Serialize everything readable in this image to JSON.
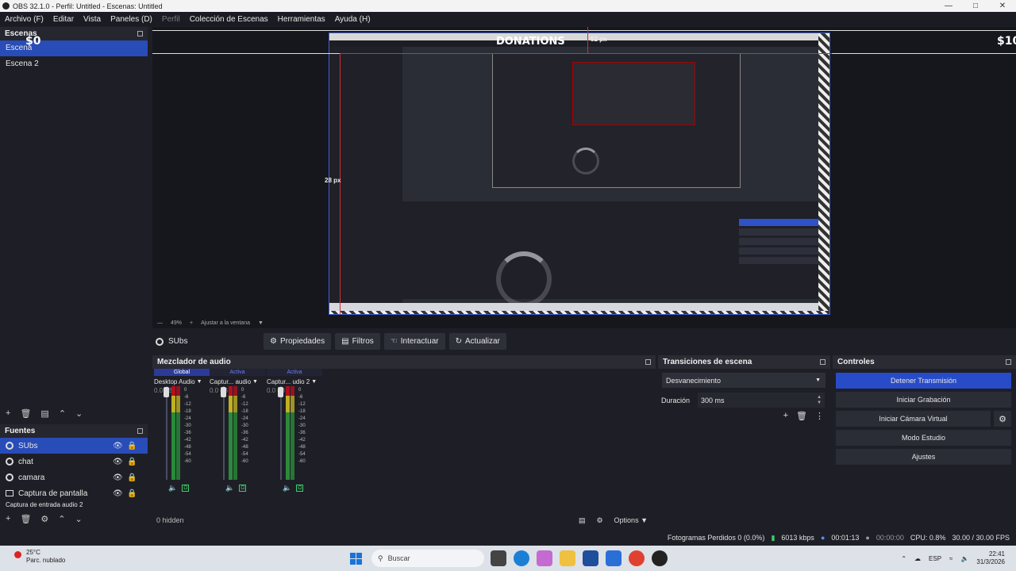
{
  "window": {
    "title": "OBS 32.1.0 - Perfil: Untitled - Escenas: Untitled"
  },
  "menu": [
    {
      "label": "Archivo (F)",
      "disabled": false
    },
    {
      "label": "Editar",
      "disabled": false
    },
    {
      "label": "Vista",
      "disabled": false
    },
    {
      "label": "Paneles (D)",
      "disabled": false
    },
    {
      "label": "Perfil",
      "disabled": true
    },
    {
      "label": "Colección de Escenas",
      "disabled": false
    },
    {
      "label": "Herramientas",
      "disabled": false
    },
    {
      "label": "Ayuda (H)",
      "disabled": false
    }
  ],
  "scenes": {
    "title": "Escenas",
    "items": [
      {
        "label": "Escena",
        "selected": true
      },
      {
        "label": "Escena 2",
        "selected": false
      }
    ]
  },
  "preview": {
    "overlay_left": "$0",
    "overlay_center": "DONATIONS",
    "overlay_right": "$10",
    "guide_top": "52 px",
    "guide_left": "28 px",
    "zoom": "49%",
    "fit_label": "Ajustar a la ventana"
  },
  "source_toolbar": {
    "source_name": "SUbs",
    "buttons": [
      {
        "label": "Propiedades",
        "icon": "gear-icon"
      },
      {
        "label": "Filtros",
        "icon": "filter-icon"
      },
      {
        "label": "Interactuar",
        "icon": "pointer-icon"
      },
      {
        "label": "Actualizar",
        "icon": "refresh-icon"
      }
    ]
  },
  "sources": {
    "title": "Fuentes",
    "items": [
      {
        "label": "SUbs",
        "selected": true
      },
      {
        "label": "chat",
        "selected": false
      },
      {
        "label": "camara",
        "selected": false
      },
      {
        "label": "Captura de pantalla",
        "selected": false
      },
      {
        "label": "Captura de entrada audio 2",
        "selected": false
      }
    ]
  },
  "mixer": {
    "title": "Mezclador de audio",
    "channels": [
      {
        "tag": "Global",
        "name": "Desktop Audio",
        "db": "0.0 dB"
      },
      {
        "tag": "Activa",
        "name": "Captur... audio",
        "db": "0.0 dB"
      },
      {
        "tag": "Activa",
        "name": "Captur... udio 2",
        "db": "0.0 dB"
      }
    ],
    "ticks": [
      "0",
      "-6",
      "-12",
      "-18",
      "-24",
      "-30",
      "-36",
      "-42",
      "-48",
      "-54",
      "-60"
    ],
    "hidden": "0 hidden",
    "options": "Options"
  },
  "transitions": {
    "title": "Transiciones de escena",
    "selected": "Desvanecimiento",
    "duration_label": "Duración",
    "duration_value": "300 ms"
  },
  "controls": {
    "title": "Controles",
    "buttons": [
      {
        "label": "Detener Transmisión",
        "active": true
      },
      {
        "label": "Iniciar Grabación",
        "active": false
      },
      {
        "label": "Iniciar Cámara Virtual",
        "active": false
      },
      {
        "label": "Modo Estudio",
        "active": false
      },
      {
        "label": "Ajustes",
        "active": false
      }
    ]
  },
  "status": {
    "dropped": "Fotogramas Perdidos 0 (0.0%)",
    "bitrate": "6013 kbps",
    "stream_time": "00:01:13",
    "rec_time": "00:00:00",
    "cpu": "CPU: 0.8%",
    "fps": "30.00 / 30.00 FPS"
  },
  "taskbar": {
    "temp": "25°C",
    "weather": "Parc. nublado",
    "search_placeholder": "Buscar",
    "lang": "ESP",
    "time": "22:41",
    "date": "31/3/2026"
  },
  "colors": {
    "accent": "#284cb8",
    "active_button": "#284cc8",
    "meter_green": "#2a8a3a"
  }
}
